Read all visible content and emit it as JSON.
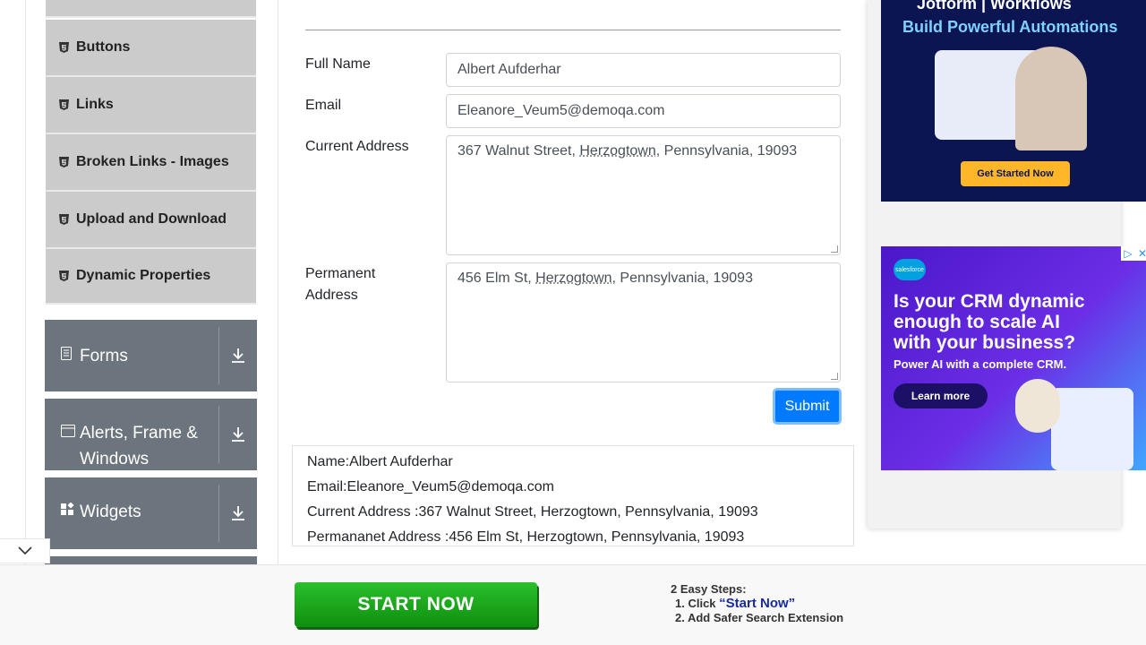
{
  "sidebar": {
    "sub_items": [
      "Buttons",
      "Links",
      "Broken Links - Images",
      "Upload and Download",
      "Dynamic Properties"
    ],
    "groups": [
      {
        "label": "Forms"
      },
      {
        "label": "Alerts, Frame &",
        "label2": "Windows"
      },
      {
        "label": "Widgets"
      }
    ]
  },
  "form": {
    "full_name_label": "Full Name",
    "full_name_value": "Albert Aufderhar",
    "email_label": "Email",
    "email_value": "Eleanore_Veum5@demoqa.com",
    "current_address_label": "Current Address",
    "current_address_pre": "367 Walnut Street, ",
    "current_address_word": "Herzogtown",
    "current_address_post": ", Pennsylvania, 19093",
    "permanent_address_label_1": "Permanent",
    "permanent_address_label_2": "Address",
    "permanent_address_pre": "456 Elm St, ",
    "permanent_address_word": "Herzogtown",
    "permanent_address_post": ", Pennsylvania, 19093",
    "submit_label": "Submit"
  },
  "output": {
    "name": "Name:Albert Aufderhar",
    "email": "Email:Eleanore_Veum5@demoqa.com",
    "current": "Current Address :367 Walnut Street, Herzogtown, Pennsylvania, 19093",
    "permanent": "Permananet Address :456 Elm St, Herzogtown, Pennsylvania, 19093"
  },
  "ads": {
    "jotform_title": "Jotform | Workflows",
    "jotform_sub": "Build Powerful Automations",
    "jotform_cta": "Get Started Now",
    "sf_logo": "salesforce",
    "sf_head_1": "Is your CRM dynamic",
    "sf_head_2": "enough to scale AI",
    "sf_head_3": "with your business?",
    "sf_sub": "Power AI with a complete CRM.",
    "sf_cta": "Learn more"
  },
  "bottom": {
    "start_label": "START NOW",
    "steps_title": "2 Easy Steps:",
    "step1_pre": "1. Click ",
    "step1_q": "“Start Now”",
    "step2": "2. Add Safer Search Extension"
  }
}
